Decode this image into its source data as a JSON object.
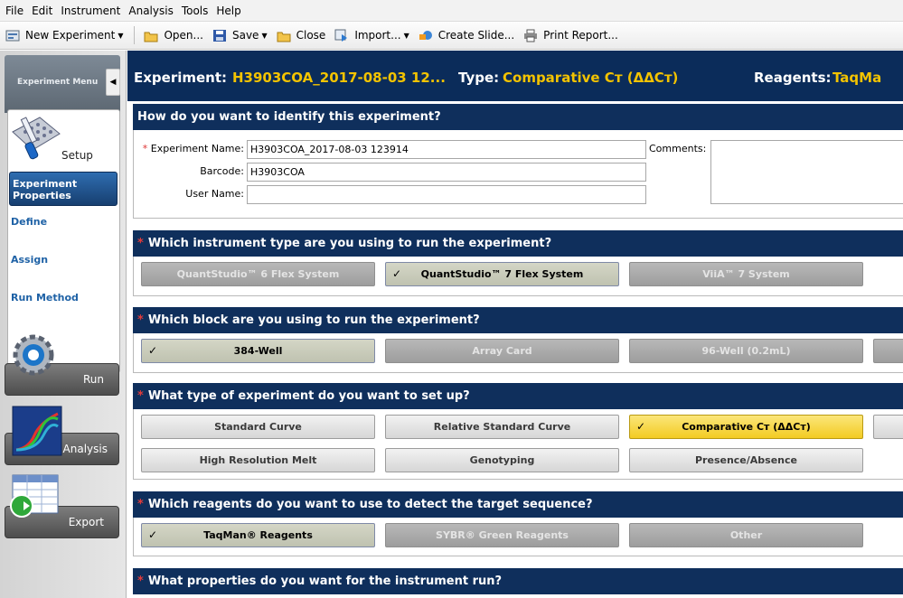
{
  "menu": [
    "File",
    "Edit",
    "Instrument",
    "Analysis",
    "Tools",
    "Help"
  ],
  "toolbar": {
    "new_experiment": "New Experiment",
    "open": "Open...",
    "save": "Save",
    "close": "Close",
    "import": "Import...",
    "create_slide": "Create Slide...",
    "print_report": "Print Report..."
  },
  "sidebar": {
    "header_title": "Experiment Menu",
    "collapse_glyph": "◀",
    "setup": "Setup",
    "experiment_properties": "Experiment Properties",
    "define": "Define",
    "assign": "Assign",
    "run_method": "Run Method",
    "run": "Run",
    "analysis": "Analysis",
    "export": "Export"
  },
  "header": {
    "experiment_label": "Experiment:",
    "experiment_value": "H3903COA_2017-08-03 12...",
    "type_label": "Type:",
    "type_value": "Comparative Cт (ΔΔCт)",
    "reagents_label": "Reagents:",
    "reagents_value": "TaqMa"
  },
  "identify": {
    "title": "How do you want to identify this experiment?",
    "required_star": "*",
    "exp_name_label": "Experiment Name:",
    "exp_name_value": "H3903COA_2017-08-03 123914",
    "barcode_label": "Barcode:",
    "barcode_value": "H3903COA",
    "user_label": "User Name:",
    "user_value": "",
    "comments_label": "Comments:"
  },
  "instrument": {
    "title": "Which instrument type are you using to run the experiment?",
    "options": [
      "QuantStudio™ 6 Flex System",
      "QuantStudio™ 7 Flex System",
      "ViiA™ 7 System"
    ]
  },
  "block": {
    "title": "Which block are you using to run the experiment?",
    "options": [
      "384-Well",
      "Array Card",
      "96-Well (0.2mL)"
    ]
  },
  "exptype": {
    "title": "What type of experiment do you want to set up?",
    "options": [
      "Standard Curve",
      "Relative Standard Curve",
      "Comparative Cт (ΔΔCт)",
      "High Resolution Melt",
      "Genotyping",
      "Presence/Absence"
    ]
  },
  "reagents": {
    "title": "Which reagents do you want to use to detect the target sequence?",
    "options": [
      "TaqMan® Reagents",
      "SYBR® Green Reagents",
      "Other"
    ]
  },
  "run_props": {
    "title": "What properties do you want for the instrument run?"
  },
  "check_glyph": "✓"
}
